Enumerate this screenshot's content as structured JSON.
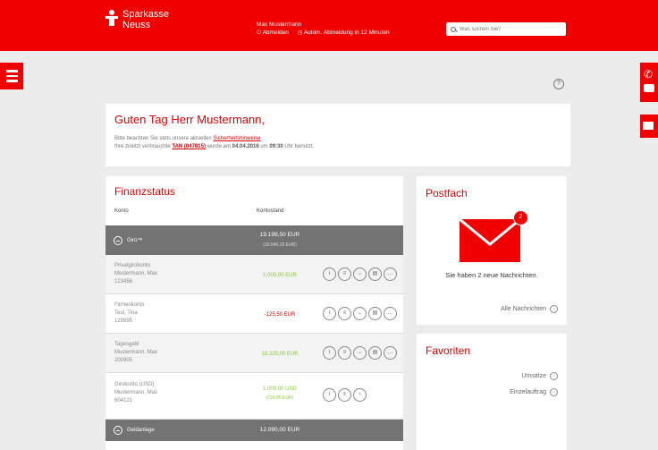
{
  "header": {
    "brand_line1": "Sparkasse",
    "brand_line2": "Neuss",
    "user_name": "Max Mustermann",
    "logout_label": "Abmelden",
    "auto_logout_label": "Autom. Abmeldung in 12 Minuten",
    "search_placeholder": "Was suchen Sie?"
  },
  "help_label": "?",
  "greeting": {
    "title": "Guten Tag Herr Mustermann,",
    "line1_text": "Bitte beachten Sie stets unsere aktuellen",
    "line1_link": "Sicherheitshinweise",
    "line2_pre": "Ihre zuletzt verbrauchte",
    "tan": "TAN (047815)",
    "line2_mid": "wurde am",
    "date": "04.04.2016",
    "line2_um": "um",
    "time": "09:30",
    "line2_post": "Uhr benutzt."
  },
  "finanzstatus": {
    "title": "Finanzstatus",
    "col_konto": "Konto",
    "col_kontostand": "Kontostand",
    "groups": [
      {
        "label": "Giro™",
        "amount": "19.199,50 EUR",
        "sub": "(19.546,15 EUR)"
      },
      {
        "label": "Geldanlage",
        "amount": "12.090,00 EUR"
      }
    ],
    "rows": [
      {
        "name": "Privatgirokonto",
        "holder": "Mustermann, Max",
        "number": "123456",
        "balance": "1.000,00 EUR"
      },
      {
        "name": "Firmenkonto",
        "holder": "Test, Tina",
        "number": "129995",
        "balance": "-125,50 EUR"
      },
      {
        "name": "Tagesgeld",
        "holder": "Mustermann, Max",
        "number": "200905",
        "balance": "18.225,00 EUR"
      },
      {
        "name": "Girokonto (USD)",
        "holder": "Mustermann, Max",
        "number": "604121",
        "balance": "1.000,00 USD",
        "balance_sub": "(724,85 EUR)"
      }
    ],
    "action_icons": [
      "info-icon",
      "list-icon",
      "transfer-icon",
      "document-icon",
      "more-icon"
    ],
    "action_glyphs": [
      "i",
      "≡",
      "↔",
      "▤",
      "…",
      "›"
    ]
  },
  "postfach": {
    "title": "Postfach",
    "badge": "2",
    "message": "Sie haben 2 neue Nachrichten.",
    "all_link": "Alle Nachrichten"
  },
  "favoriten": {
    "title": "Favoriten",
    "links": [
      "Umsätze",
      "Einzelauftrag"
    ]
  },
  "colors": {
    "brand_red": "#f10000",
    "positive": "#8dc63f",
    "negative": "#e00000",
    "group_gray": "#737373"
  }
}
